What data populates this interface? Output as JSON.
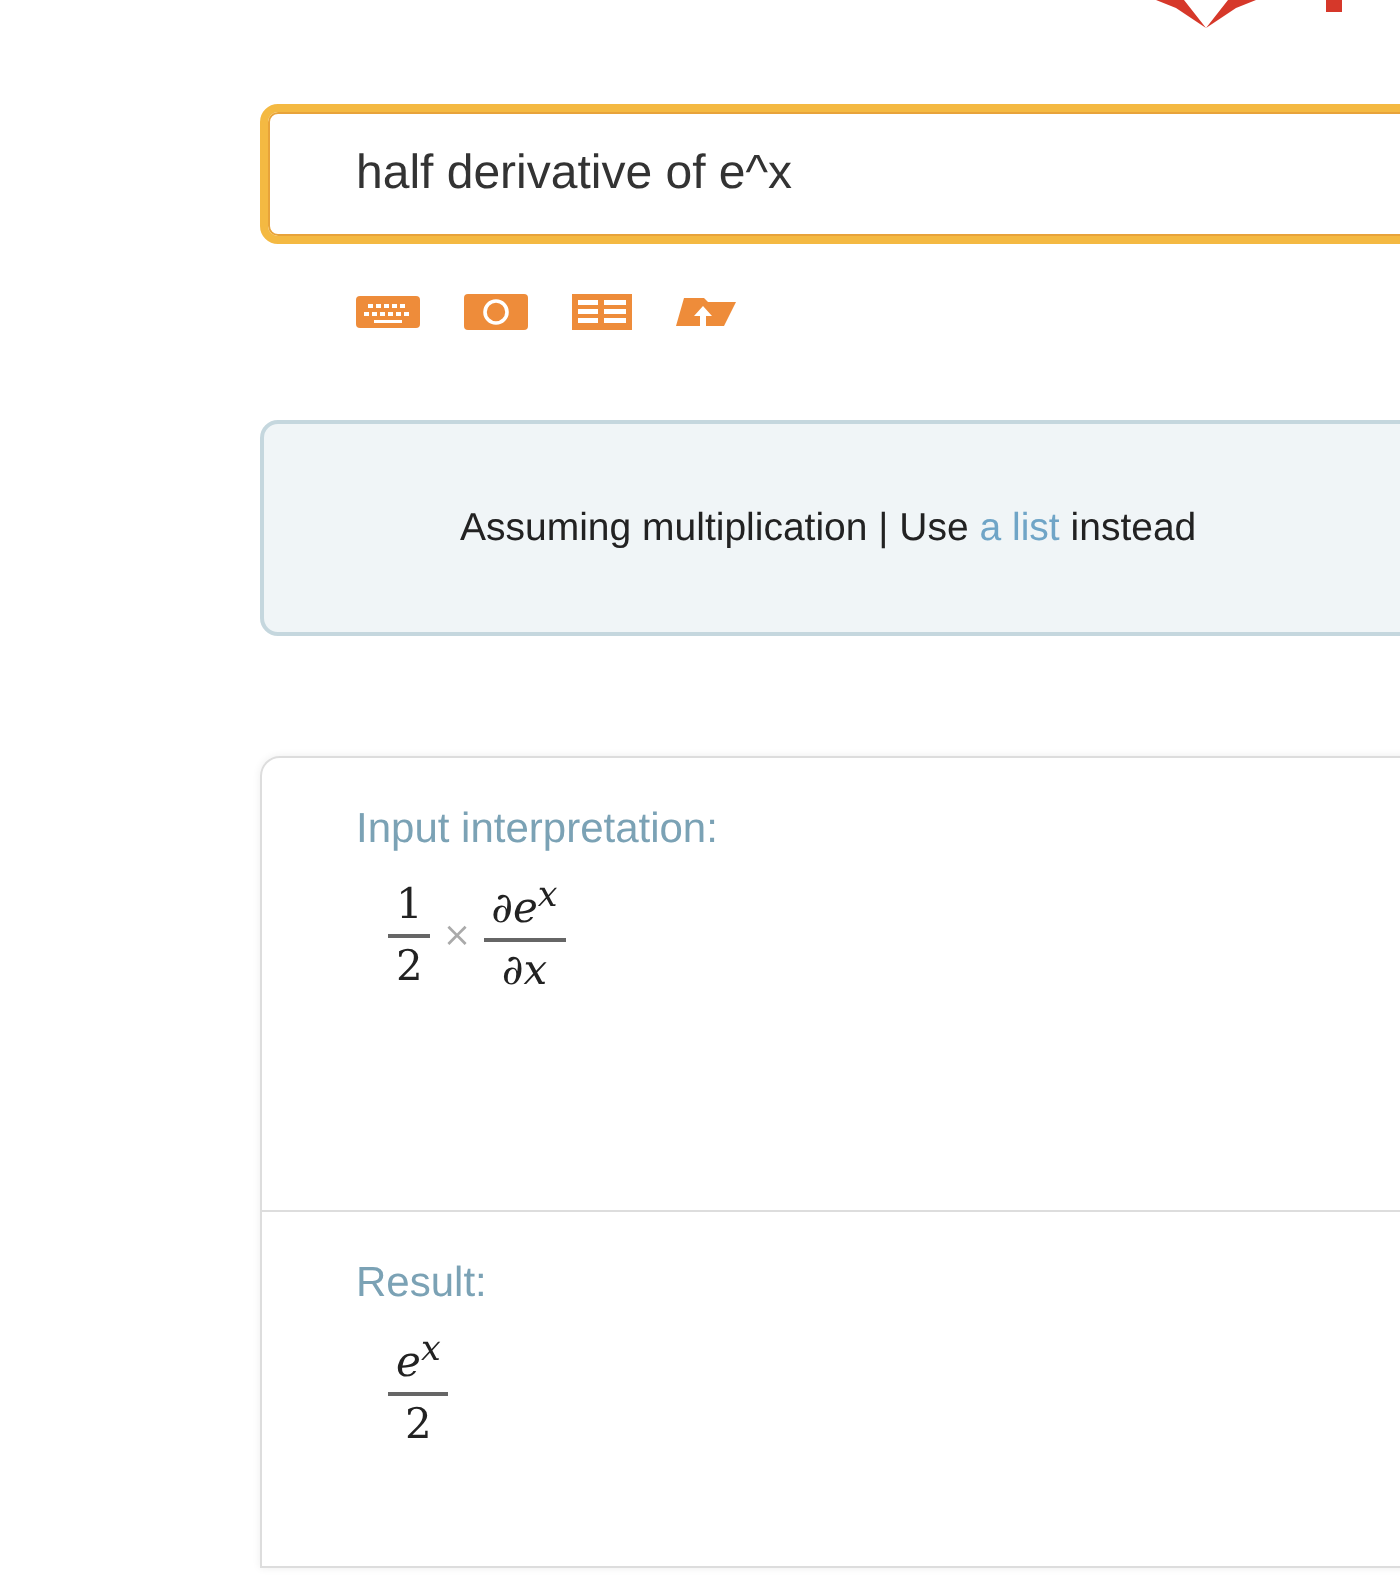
{
  "search": {
    "value": "half derivative of e^x"
  },
  "input_tools": [
    {
      "kind": "keyboard"
    },
    {
      "kind": "camera"
    },
    {
      "kind": "table"
    },
    {
      "kind": "upload"
    }
  ],
  "assumption": {
    "text": "Assuming multiplication | Use ",
    "link": "a list",
    "after": " instead"
  },
  "pods": [
    {
      "title": "Input interpretation:",
      "kind": "product",
      "terms": [
        {
          "numerator": "1",
          "denominator": "2"
        },
        {
          "numerator": "∂e$^{x}$",
          "denominator": "∂x"
        }
      ],
      "operator": "×"
    },
    {
      "title": "Result:",
      "kind": "fraction",
      "terms": [
        {
          "numerator": "e$^{x}$",
          "denominator": "2"
        }
      ]
    }
  ]
}
